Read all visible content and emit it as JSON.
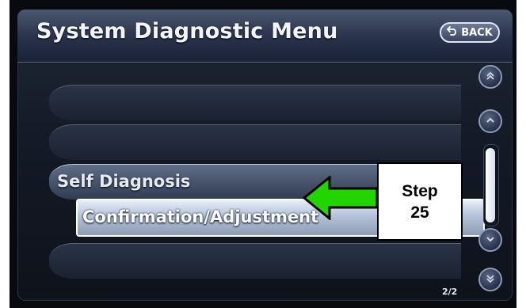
{
  "header": {
    "title": "System Diagnostic Menu",
    "back_label": "BACK"
  },
  "menu": {
    "items": [
      {
        "label": "Self Diagnosis",
        "selected": false
      },
      {
        "label": "Confirmation/Adjustment",
        "selected": true
      }
    ]
  },
  "pagination": {
    "text": "2/2"
  },
  "annotation": {
    "line1": "Step",
    "line2": "25"
  },
  "colors": {
    "arrow_fill": "#22d400",
    "arrow_stroke": "#000000",
    "screen_background": "#141a26"
  },
  "icons": {
    "back": "return-arrow-icon",
    "scroll_top": "double-chevron-up-icon",
    "scroll_up": "chevron-up-icon",
    "scroll_down": "chevron-down-icon",
    "scroll_bottom": "double-chevron-down-icon"
  }
}
